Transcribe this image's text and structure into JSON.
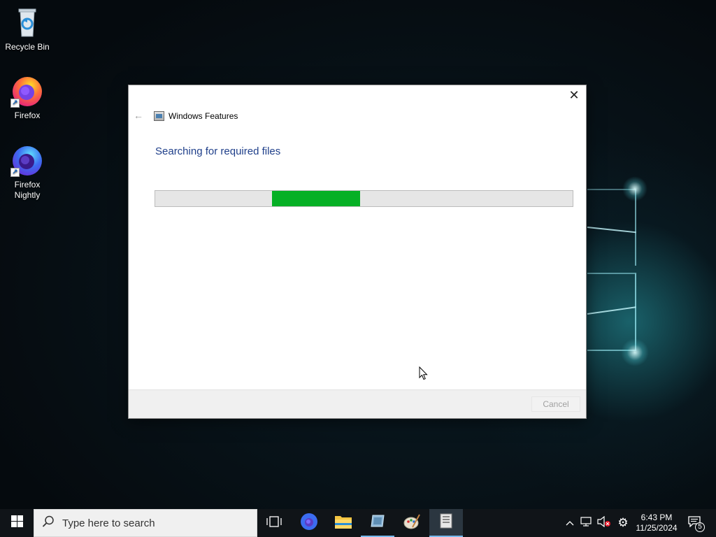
{
  "desktop": {
    "icons": [
      {
        "label": "Recycle Bin",
        "icon": "recycle-bin-icon"
      },
      {
        "label": "Firefox",
        "icon": "firefox-icon"
      },
      {
        "label": "Firefox Nightly",
        "icon": "firefox-nightly-icon"
      }
    ]
  },
  "dialog": {
    "title": "Windows Features",
    "heading": "Searching for required files",
    "progress_fraction_start": 0.28,
    "progress_fraction_end": 0.49,
    "cancel_label": "Cancel",
    "close_glyph": "✕",
    "back_glyph": "←",
    "accent_color": "#06b025",
    "heading_color": "#1f3f8a"
  },
  "taskbar": {
    "search_placeholder": "Type here to search",
    "pinned": [
      "task-view-icon",
      "firefox-icon",
      "file-explorer-icon",
      "app-icon",
      "paint-icon",
      "windows-features-icon"
    ],
    "tray": {
      "time": "6:43 PM",
      "date": "11/25/2024",
      "notification_count": "5"
    }
  }
}
